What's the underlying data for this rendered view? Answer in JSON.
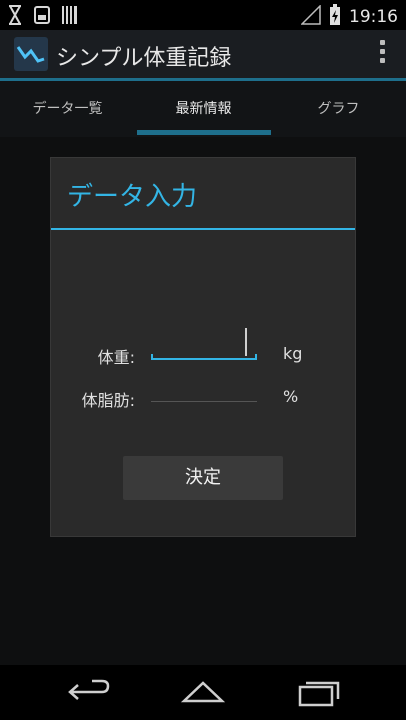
{
  "status_bar": {
    "time": "19:16",
    "icons": [
      "hourglass-icon",
      "sd-card-icon",
      "barcode-icon",
      "signal-icon",
      "battery-charging-icon"
    ]
  },
  "action_bar": {
    "title": "シンプル体重記録",
    "app_icon": "weight-graph-icon",
    "overflow_icon": "overflow-menu-icon"
  },
  "tabs": [
    {
      "label": "データ一覧",
      "selected": false
    },
    {
      "label": "最新情報",
      "selected": true
    },
    {
      "label": "グラフ",
      "selected": false
    }
  ],
  "dialog": {
    "title": "データ入力",
    "weight": {
      "label": "体重:",
      "value": "",
      "unit": "kg"
    },
    "body_fat": {
      "label": "体脂肪:",
      "value": "",
      "unit": "%"
    },
    "confirm_label": "決定"
  },
  "navigation": {
    "icons": [
      "back-icon",
      "home-icon",
      "recents-icon"
    ]
  },
  "colors": {
    "accent": "#33b5e5",
    "action_bar_underline": "#1e6f8c"
  }
}
